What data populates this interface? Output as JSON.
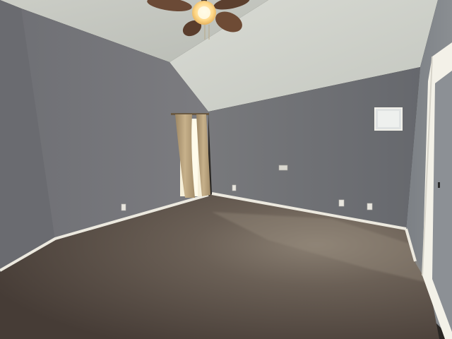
{
  "scene": {
    "subject": "empty-bedroom-interior",
    "colors": {
      "wall_left": "#737378",
      "wall_back": "#6c6e72",
      "wall_right": "#7a7d82",
      "ceiling": "#c9ccc4",
      "ceiling_slope": "#d4d6cf",
      "baseboard": "#ece9df",
      "carpet": "#4f453f",
      "carpet_light": "#857a6c",
      "curtain": "#b9a27e",
      "window_light": "#f6efd9",
      "door_trim": "#f3f1e8",
      "fan_blade": "#6b4a36",
      "fan_light": "#ffe9b5"
    },
    "icons": [
      "ceiling-fan-icon",
      "light-fixture-icon",
      "window-icon",
      "curtain-icon",
      "electrical-outlet-icon",
      "door-frame-icon"
    ]
  }
}
